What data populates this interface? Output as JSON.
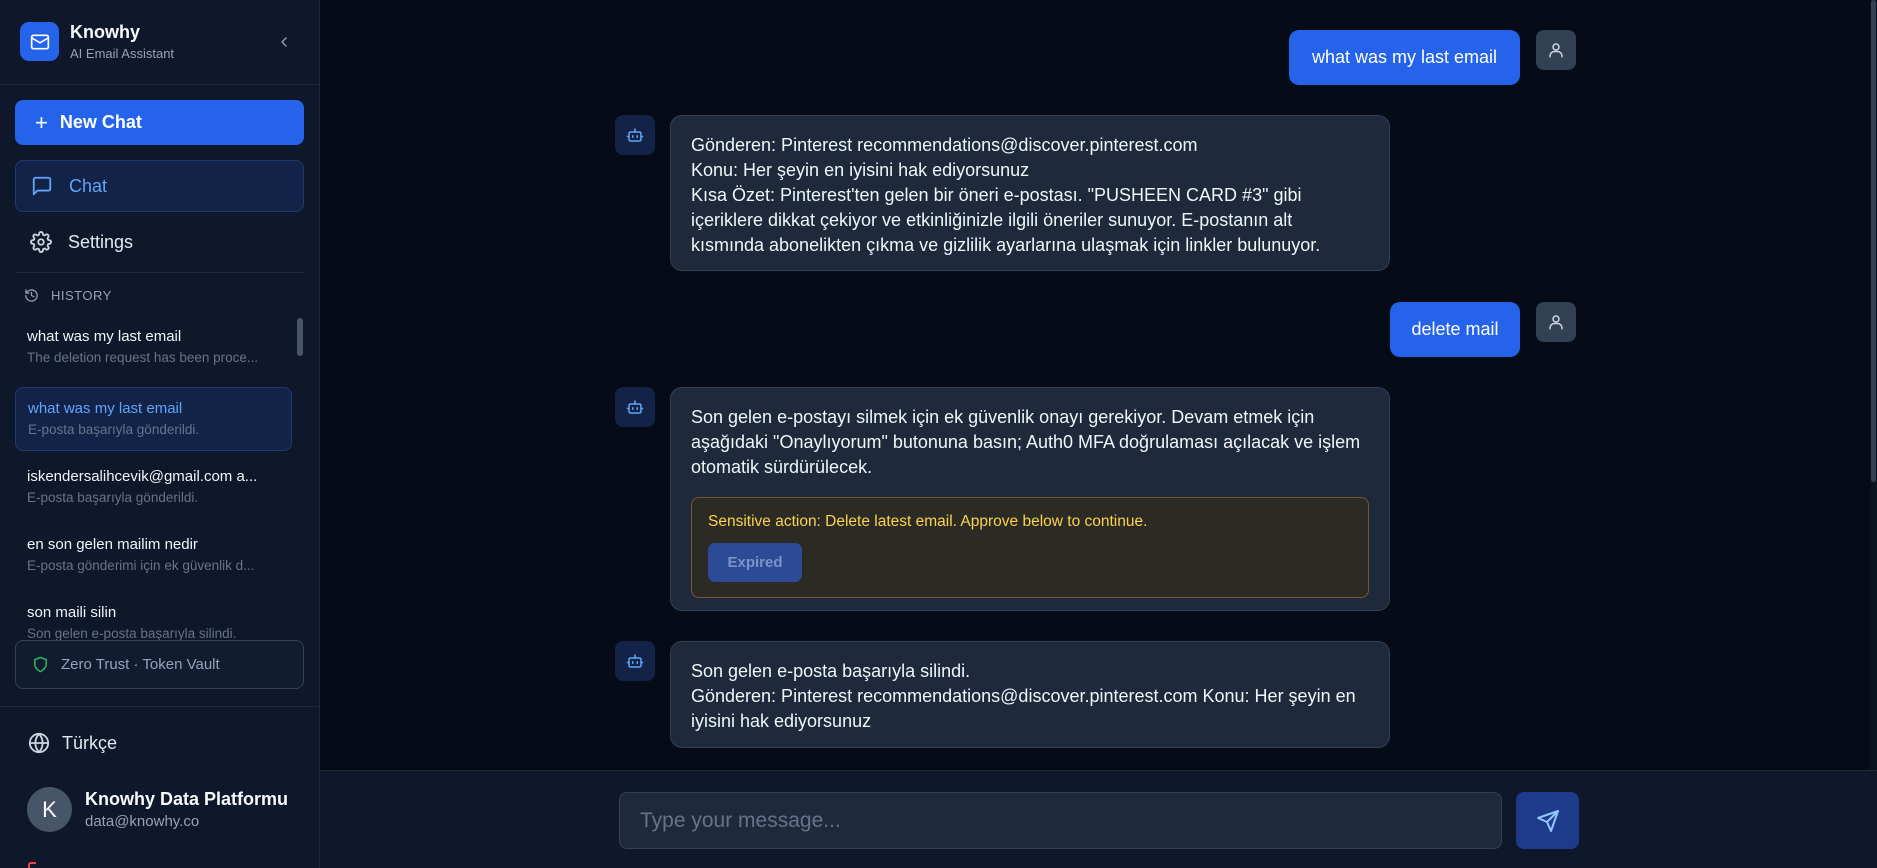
{
  "brand": {
    "name": "Knowhy",
    "subtitle": "AI Email Assistant"
  },
  "sidebar": {
    "new_chat_label": "New Chat",
    "nav": {
      "chat": "Chat",
      "settings": "Settings"
    },
    "history_heading": "HISTORY",
    "history": [
      {
        "title": "what was my last email",
        "preview": "The deletion request has been proce..."
      },
      {
        "title": "what was my last email",
        "preview": "E-posta başarıyla gönderildi.",
        "active": true
      },
      {
        "title": "iskendersalihcevik@gmail.com a...",
        "preview": "E-posta başarıyla gönderildi."
      },
      {
        "title": "en son gelen mailim nedir",
        "preview": "E-posta gönderimi için ek güvenlik d..."
      },
      {
        "title": "son maili silin",
        "preview": "Son gelen e-posta başarıyla silindi."
      }
    ],
    "zero_trust": "Zero Trust · Token Vault",
    "language": "Türkçe",
    "user": {
      "initial": "K",
      "name": "Knowhy Data Platformu",
      "email": "data@knowhy.co"
    }
  },
  "conversation": {
    "user_msg_1": "what was my last email",
    "bot_msg_1": [
      "Gönderen: Pinterest recommendations@discover.pinterest.com",
      "Konu: Her şeyin en iyisini hak ediyorsunuz",
      "Kısa Özet: Pinterest'ten gelen bir öneri e-postası. \"PUSHEEN CARD #3\" gibi içeriklere dikkat çekiyor ve etkinliğinizle ilgili öneriler sunuyor. E-postanın alt kısmında abonelikten çıkma ve gizlilik ayarlarına ulaşmak için linkler bulunuyor."
    ],
    "user_msg_2": "delete mail",
    "bot_msg_2": "Son gelen e-postayı silmek için ek güvenlik onayı gerekiyor. Devam etmek için aşağıdaki \"Onaylıyorum\" butonuna basın; Auth0 MFA doğrulaması açılacak ve işlem otomatik sürdürülecek.",
    "sensitive_notice": "Sensitive action: Delete latest email. Approve below to continue.",
    "approve_button_label": "Expired",
    "bot_msg_3": [
      "Son gelen e-posta başarıyla silindi.",
      "Gönderen: Pinterest recommendations@discover.pinterest.com Konu: Her şeyin en iyisini hak ediyorsunuz"
    ]
  },
  "composer": {
    "placeholder": "Type your message..."
  },
  "colors": {
    "accent": "#2563eb",
    "background": "#050b17",
    "sidebar": "#0f172a",
    "bubble": "#1e293b",
    "warning": "#fcd34d",
    "success": "#22c55e"
  },
  "icons": [
    "mail-icon",
    "chevron-left-icon",
    "plus-icon",
    "message-square-icon",
    "gear-icon",
    "history-icon",
    "shield-icon",
    "globe-icon",
    "user-icon",
    "bot-icon",
    "send-icon"
  ]
}
